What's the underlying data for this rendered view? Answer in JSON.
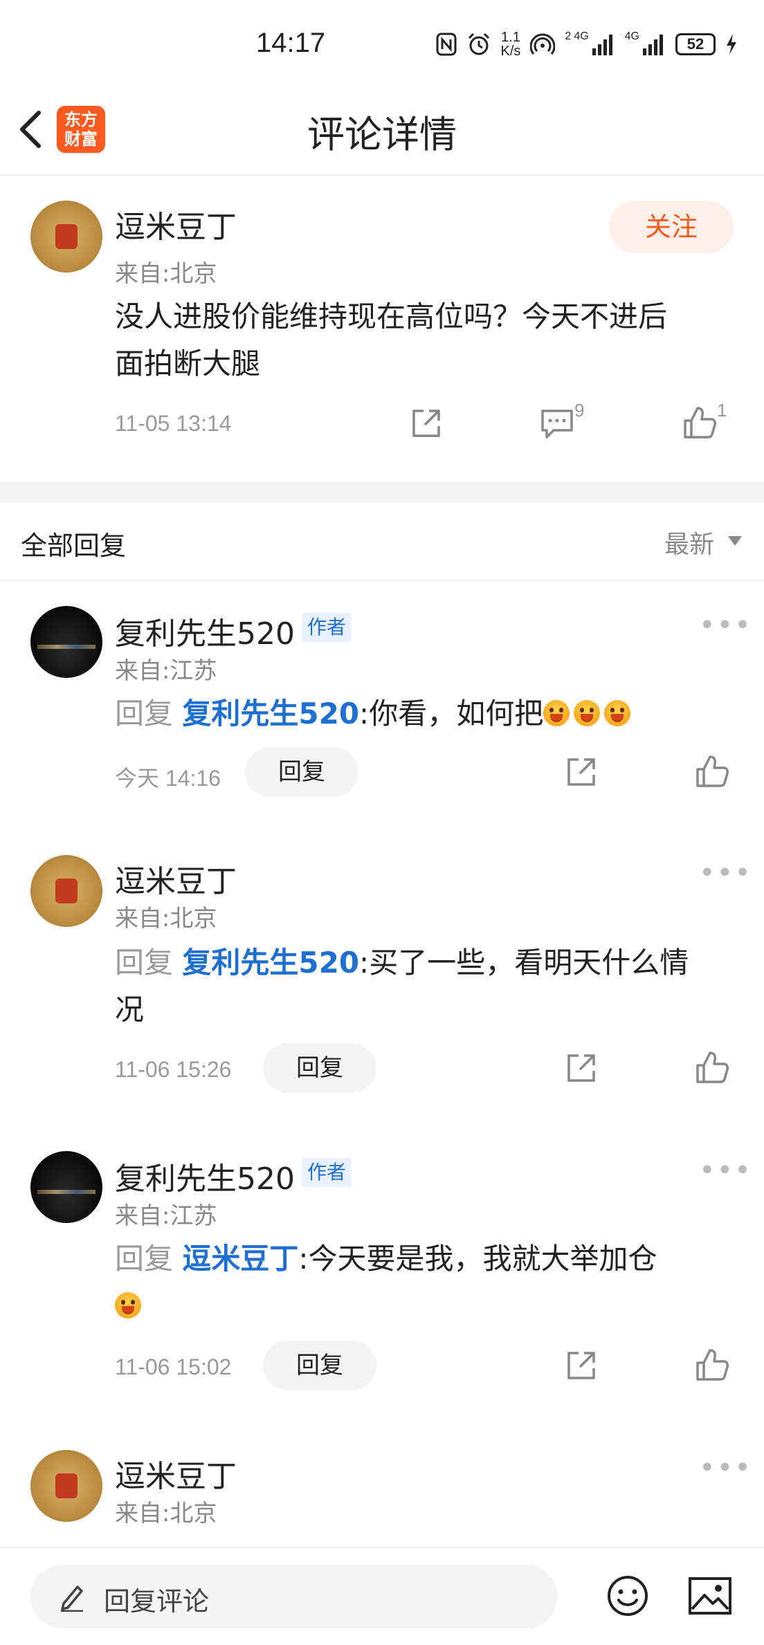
{
  "status_bar": {
    "time": "14:17",
    "net_speed_top": "1.1",
    "net_speed_bottom": "K/s",
    "signal_label_1": "4G",
    "signal_label_2": "4G",
    "wifi_badge": "2",
    "battery": "52",
    "icons": [
      "nfc-icon",
      "alarm-icon",
      "hotspot-icon",
      "signal-icon",
      "signal-icon",
      "battery-icon",
      "charging-icon"
    ]
  },
  "nav": {
    "title": "评论详情",
    "logo_line1": "东方",
    "logo_line2": "财富"
  },
  "post": {
    "author": "逗米豆丁",
    "from": "来自:北京",
    "follow_label": "关注",
    "content_line1": "没人进股价能维持现在高位吗？今天不进后",
    "content_line2": "面拍断大腿",
    "time": "11-05 13:14",
    "comment_count": "9",
    "like_count": "1"
  },
  "replies_header": {
    "title": "全部回复",
    "sort": "最新"
  },
  "replies": [
    {
      "author": "复利先生520",
      "badge": "作者",
      "from": "来自:江苏",
      "prefix": "回复",
      "target": "复利先生520",
      "text": ":你看，如何把",
      "time": "今天 14:16",
      "reply_label": "回复"
    },
    {
      "author": "逗米豆丁",
      "from": "来自:北京",
      "prefix": "回复",
      "target": "复利先生520",
      "text": ":买了一些，看明天什么情",
      "text_line2": "况",
      "time": "11-06 15:26",
      "reply_label": "回复"
    },
    {
      "author": "复利先生520",
      "badge": "作者",
      "from": "来自:江苏",
      "prefix": "回复",
      "target": "逗米豆丁",
      "text": ":今天要是我，我就大举加仓",
      "time": "11-06 15:02",
      "reply_label": "回复"
    },
    {
      "author": "逗米豆丁",
      "from": "来自:北京"
    }
  ],
  "bottom_bar": {
    "placeholder": "回复评论"
  },
  "colors": {
    "accent": "#ff5a1f",
    "link": "#1e6fd0",
    "muted": "#999999"
  }
}
